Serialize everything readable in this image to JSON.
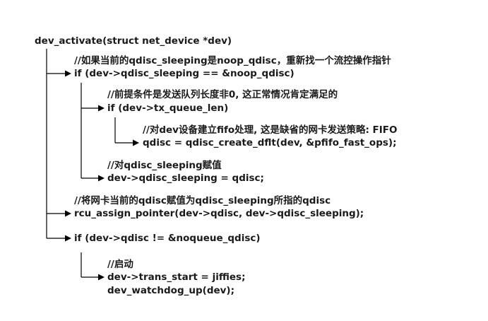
{
  "diagram": {
    "root": "dev_activate(struct net_device *dev)",
    "comment_noop": "//如果当前的qdisc_sleeping是noop_qdisc，重新找一个流控操作指针",
    "if_noop": "if (dev->qdisc_sleeping == &noop_qdisc)",
    "comment_precond": "//前提条件是发送队列长度非0, 这正常情况肯定满足的",
    "if_txq": "if (dev->tx_queue_len)",
    "comment_fifo": "//对dev设备建立fifo处理, 这是缺省的网卡发送策略: FIFO",
    "create_dflt": "qdisc = qdisc_create_dflt(dev, &pfifo_fast_ops);",
    "comment_assign": "//对qdisc_sleeping赋值",
    "assign_sleeping": "dev->qdisc_sleeping = qdisc;",
    "comment_rcu": "//将网卡当前的qdisc赋值为qdisc_sleeping所指的qdisc",
    "rcu_assign": "rcu_assign_pointer(dev->qdisc, dev->qdisc_sleeping);",
    "if_noqueue": "if (dev->qdisc != &noqueue_qdisc)",
    "comment_start": "//启动",
    "trans_start": "dev->trans_start = jiffies;",
    "watchdog": "dev_watchdog_up(dev);"
  },
  "colors": {
    "text": "#1a1a1a",
    "line": "#000000",
    "background": "#ffffff"
  }
}
